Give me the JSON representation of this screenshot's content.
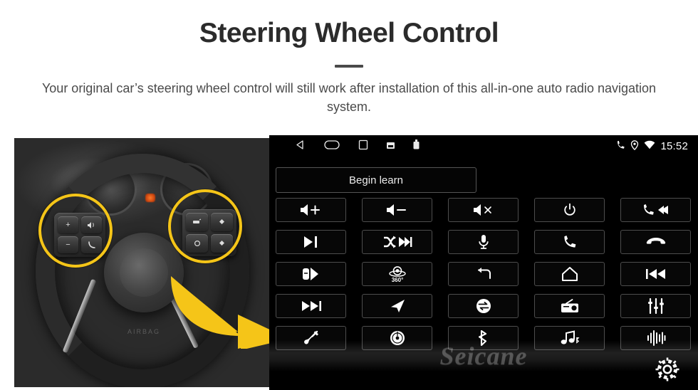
{
  "header": {
    "title": "Steering Wheel Control",
    "subtitle": "Your original car’s steering wheel control will still work after installation of this all-in-one auto radio navigation system."
  },
  "colors": {
    "accent_yellow": "#f5c518",
    "panel_black": "#000000",
    "cell_border": "#4d4d4d",
    "title_gray": "#2b2b2b"
  },
  "photo": {
    "alt": "car steering wheel with original control buttons highlighted",
    "left_pad_keys": [
      "+",
      "−",
      "volume-speaker",
      "call"
    ],
    "right_pad_keys": [
      "mode",
      "up",
      "menu",
      "down"
    ],
    "highlight_labels": [
      "left-control-pad-highlight",
      "right-control-pad-highlight"
    ],
    "arrow_label": "pointing-arrow"
  },
  "head_unit": {
    "statusbar": {
      "nav": [
        "back-icon",
        "home-icon",
        "recents-icon",
        "sd-card-icon",
        "usb-icon"
      ],
      "right_icons": [
        "phone-icon",
        "location-icon",
        "wifi-icon"
      ],
      "clock": "15:52"
    },
    "begin_learn_label": "Begin learn",
    "watermark": "Seicane",
    "settings_label": "settings-gear",
    "buttons": [
      {
        "name": "volume-up",
        "icon": "speaker-plus"
      },
      {
        "name": "volume-down",
        "icon": "speaker-minus"
      },
      {
        "name": "mute",
        "icon": "speaker-x"
      },
      {
        "name": "power",
        "icon": "power"
      },
      {
        "name": "call-previous",
        "icon": "phone-prev"
      },
      {
        "name": "play-pause",
        "icon": "play-pause"
      },
      {
        "name": "shuffle-next",
        "icon": "shuffle-next"
      },
      {
        "name": "voice-mic",
        "icon": "mic"
      },
      {
        "name": "answer-call",
        "icon": "phone"
      },
      {
        "name": "hang-up",
        "icon": "phone-hangup"
      },
      {
        "name": "rear-camera",
        "icon": "car-camera"
      },
      {
        "name": "camera-360",
        "icon": "camera-360"
      },
      {
        "name": "back",
        "icon": "back-arrow"
      },
      {
        "name": "home",
        "icon": "house"
      },
      {
        "name": "previous-track",
        "icon": "prev-track"
      },
      {
        "name": "next-track",
        "icon": "next-track"
      },
      {
        "name": "navigation",
        "icon": "nav-arrow"
      },
      {
        "name": "source-switch",
        "icon": "source-swap"
      },
      {
        "name": "radio",
        "icon": "radio"
      },
      {
        "name": "equalizer",
        "icon": "equalizer"
      },
      {
        "name": "aux-usb",
        "icon": "cable"
      },
      {
        "name": "disc",
        "icon": "disc"
      },
      {
        "name": "bluetooth",
        "icon": "bluetooth"
      },
      {
        "name": "bluetooth-music",
        "icon": "bt-music"
      },
      {
        "name": "voice-wave",
        "icon": "sound-wave"
      }
    ],
    "camera_360_label": "360°"
  }
}
